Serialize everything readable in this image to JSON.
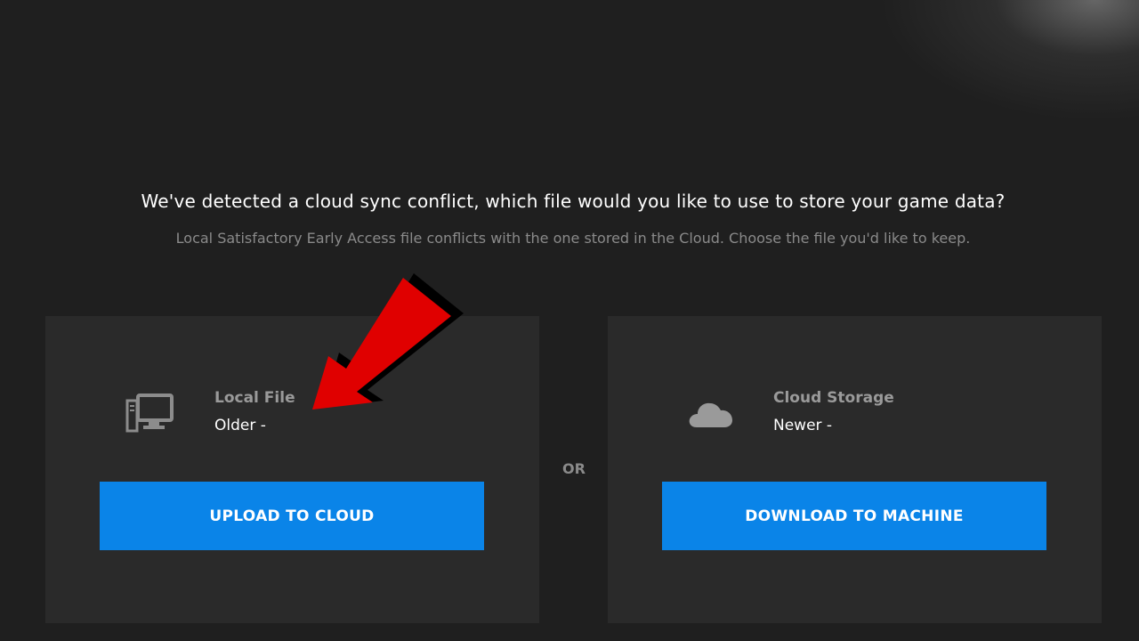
{
  "dialog": {
    "heading": "We've detected a cloud sync conflict, which file would you like to use to store your game data?",
    "subheading": "Local Satisfactory Early Access file conflicts with the one stored in the Cloud. Choose the file you'd like to keep."
  },
  "local": {
    "icon": "desktop-computer-icon",
    "name": "Local File",
    "age": "Older -",
    "button_label": "UPLOAD TO CLOUD"
  },
  "separator": "OR",
  "cloud": {
    "icon": "cloud-icon",
    "name": "Cloud Storage",
    "age": "Newer -",
    "button_label": "DOWNLOAD TO MACHINE"
  },
  "colors": {
    "background": "#1f1f1f",
    "card": "#2a2a2a",
    "button": "#0a84e8",
    "annotation_arrow": "#e00000"
  }
}
